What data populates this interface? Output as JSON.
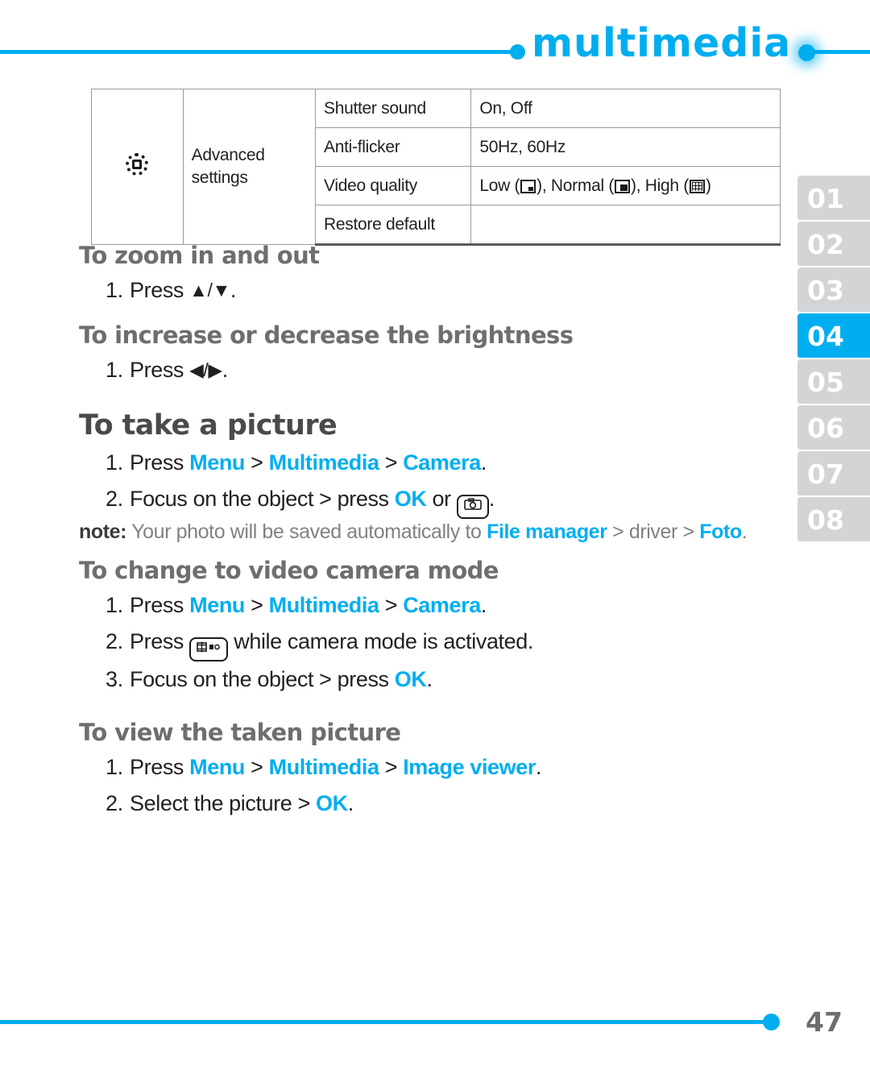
{
  "header": {
    "brand": "multimedia",
    "accent_color": "#00AEEF",
    "left_dot": "dot",
    "right_dot": "glow-dot"
  },
  "chapter_rail": {
    "active": "04",
    "tabs": [
      "01",
      "02",
      "03",
      "04",
      "05",
      "06",
      "07",
      "08"
    ]
  },
  "table": {
    "group_icon": "gear-icon",
    "group_label": "Advanced settings",
    "rows": [
      {
        "name": "Shutter sound",
        "value": "On, Off"
      },
      {
        "name": "Anti-flicker",
        "value": "50Hz, 60Hz"
      },
      {
        "name": "Video quality",
        "value_prefix": "Low (",
        "value_mid1": "), Normal (",
        "value_mid2": "), High (",
        "value_suffix": ")"
      },
      {
        "name": "Restore default",
        "value": ""
      }
    ]
  },
  "sections": [
    {
      "id": "zoom",
      "heading": "To zoom in and out",
      "steps": [
        {
          "num": "1.",
          "pre": "Press ",
          "glyph": "▲/▼",
          "post": "."
        }
      ]
    },
    {
      "id": "brightness",
      "heading": "To increase or decrease the brightness",
      "steps": [
        {
          "num": "1.",
          "pre": "Press ",
          "glyph": "◀/▶",
          "post": "."
        }
      ]
    },
    {
      "id": "take-picture",
      "heading": "To take a picture",
      "big": true,
      "steps": [
        {
          "num": "1.",
          "pre": "Press ",
          "l1": "Menu",
          "s1": " > ",
          "l2": "Multimedia",
          "s2": " > ",
          "l3": "Camera",
          "post": "."
        },
        {
          "num": "2.",
          "pre": "Focus on the object > press ",
          "l1": "OK",
          "s1": " or ",
          "icon": "camera-key-icon",
          "post": "."
        }
      ],
      "note": {
        "label": "note:",
        "t1": " Your photo will be saved automatically to ",
        "link1": "File manager",
        "t2": " > driver > ",
        "link2": "Foto",
        "t3": "."
      }
    },
    {
      "id": "video-mode",
      "heading": "To change to video camera mode",
      "steps": [
        {
          "num": "1.",
          "pre": "Press ",
          "l1": "Menu",
          "s1": " > ",
          "l2": "Multimedia",
          "s2": " > ",
          "l3": "Camera",
          "post": "."
        },
        {
          "num": "2.",
          "pre": "Press ",
          "icon": "video-key-icon",
          "post": " while camera mode is activated."
        },
        {
          "num": "3.",
          "pre": "Focus on the object > press ",
          "l1": "OK",
          "post": "."
        }
      ]
    },
    {
      "id": "view-picture",
      "heading": "To view the taken picture",
      "steps": [
        {
          "num": "1.",
          "pre": "Press ",
          "l1": "Menu",
          "s1": " > ",
          "l2": "Multimedia",
          "s2": " > ",
          "l3": "Image viewer",
          "post": "."
        },
        {
          "num": "2.",
          "pre": "Select the picture > ",
          "l1": "OK",
          "post": "."
        }
      ]
    }
  ],
  "footer": {
    "page_number": "47"
  }
}
